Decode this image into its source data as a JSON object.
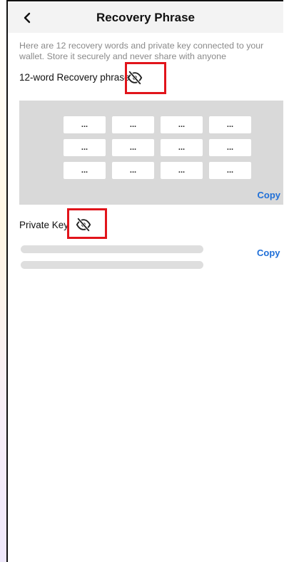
{
  "header": {
    "title": "Recovery Phrase",
    "back_icon": "chevron-left-icon"
  },
  "description": "Here are 12 recovery words and private key connected to your wallet. Store it securely and never share with anyone",
  "recovery": {
    "label": "12-word Recovery phrase",
    "toggle_icon": "eye-slash-icon",
    "words": [
      "...",
      "...",
      "...",
      "...",
      "...",
      "...",
      "...",
      "...",
      "...",
      "...",
      "...",
      "..."
    ],
    "copy_label": "Copy"
  },
  "private_key": {
    "label": "Private Key",
    "toggle_icon": "eye-slash-icon",
    "copy_label": "Copy"
  },
  "colors": {
    "accent": "#1f6fd8",
    "highlight": "#e1141b",
    "panel": "#d9d9d9"
  }
}
